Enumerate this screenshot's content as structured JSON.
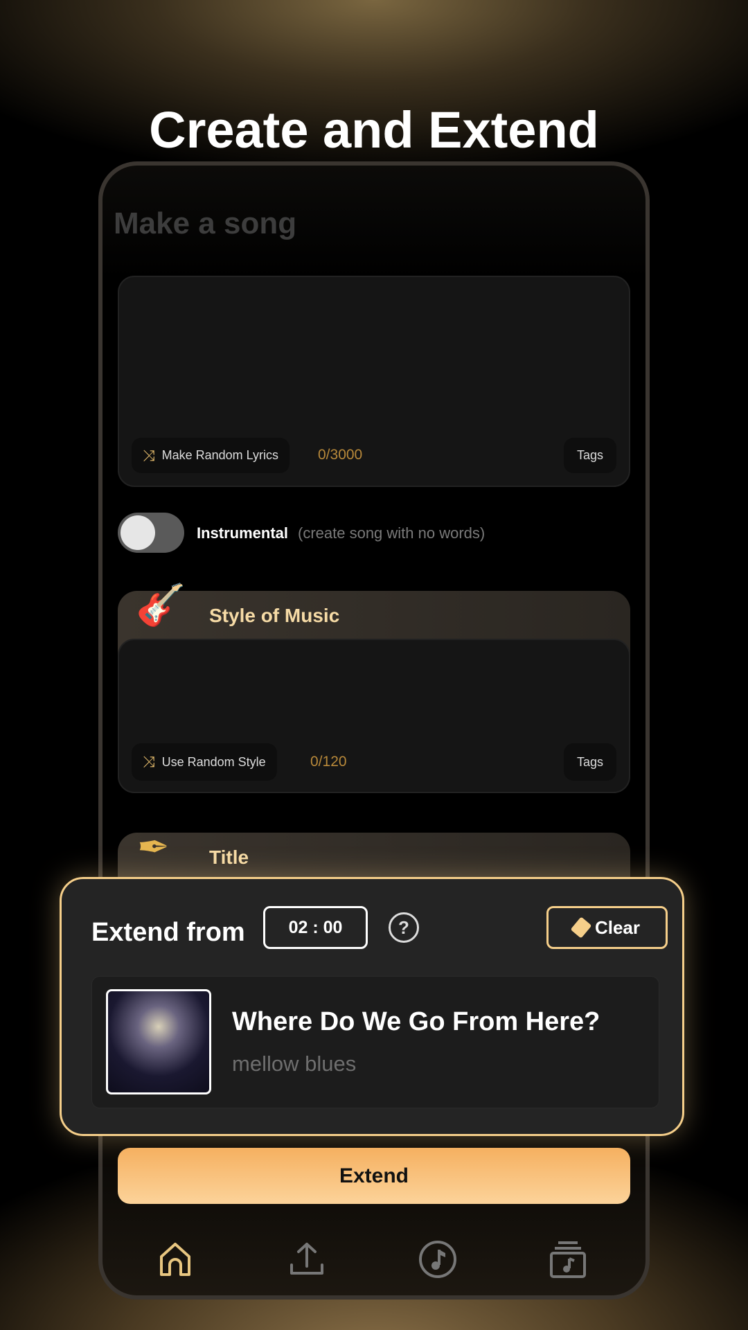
{
  "headline": "Create and Extend",
  "screen": {
    "title": "Make a song",
    "lyrics": {
      "random_label": "Make Random Lyrics",
      "counter": "0/3000",
      "tags_label": "Tags"
    },
    "instrumental": {
      "label": "Instrumental",
      "hint": "(create song with no words)",
      "on": false
    },
    "style": {
      "title": "Style of Music",
      "random_label": "Use Random Style",
      "counter": "0/120",
      "tags_label": "Tags"
    },
    "title_section": {
      "title": "Title"
    }
  },
  "extend_panel": {
    "label": "Extend from",
    "time": "02 : 00",
    "clear_label": "Clear",
    "song": {
      "title": "Where Do We Go From Here?",
      "style": "mellow blues"
    }
  },
  "extend_button": "Extend",
  "nav": [
    {
      "icon": "home-icon",
      "active": true
    },
    {
      "icon": "upload-icon"
    },
    {
      "icon": "music-note-icon"
    },
    {
      "icon": "library-icon"
    }
  ],
  "colors": {
    "accent": "#f6cf8a",
    "counter": "#b8893a",
    "button_top": "#f5b060",
    "button_bottom": "#fcd39a"
  }
}
